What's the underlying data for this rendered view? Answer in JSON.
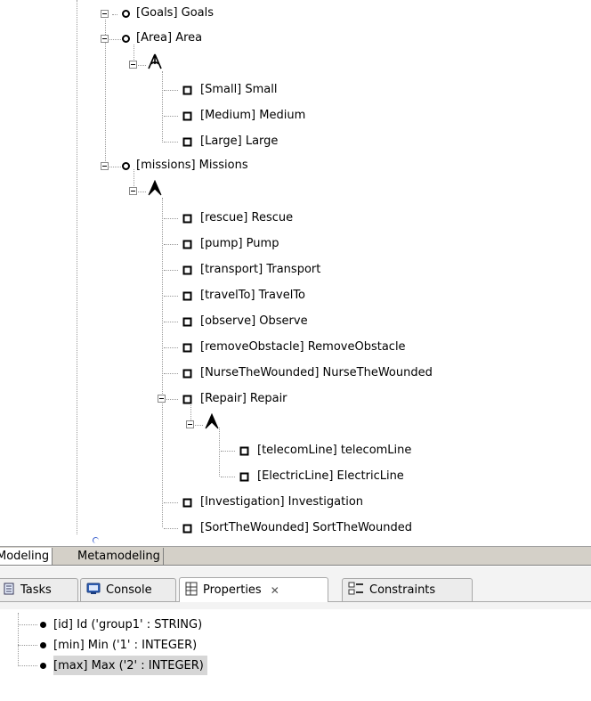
{
  "tree": {
    "goals": "[Goals] Goals",
    "area": "[Area] Area",
    "small": "[Small] Small",
    "medium": "[Medium] Medium",
    "large": "[Large] Large",
    "missions": "[missions] Missions",
    "rescue": "[rescue] Rescue",
    "pump": "[pump] Pump",
    "transport": "[transport] Transport",
    "travelTo": "[travelTo] TravelTo",
    "observe": "[observe] Observe",
    "removeObstacle": "[removeObstacle] RemoveObstacle",
    "nurse": "[NurseTheWounded] NurseTheWounded",
    "repair": "[Repair] Repair",
    "telecom": "[telecomLine] telecomLine",
    "electric": "[ElectricLine] ElectricLine",
    "investigation": "[Investigation] Investigation",
    "sort": "[SortTheWounded] SortTheWounded"
  },
  "editor_tabs": {
    "modeling": "Modeling",
    "metamodeling": "Metamodeling"
  },
  "views": {
    "tasks": "Tasks",
    "console": "Console",
    "properties": "Properties",
    "properties_close": "✕",
    "constraints": "Constraints"
  },
  "properties": [
    {
      "text": "[id] Id ('group1' : STRING)"
    },
    {
      "text": "[min] Min ('1' : INTEGER)"
    },
    {
      "text": "[max] Max ('2' : INTEGER)"
    }
  ]
}
